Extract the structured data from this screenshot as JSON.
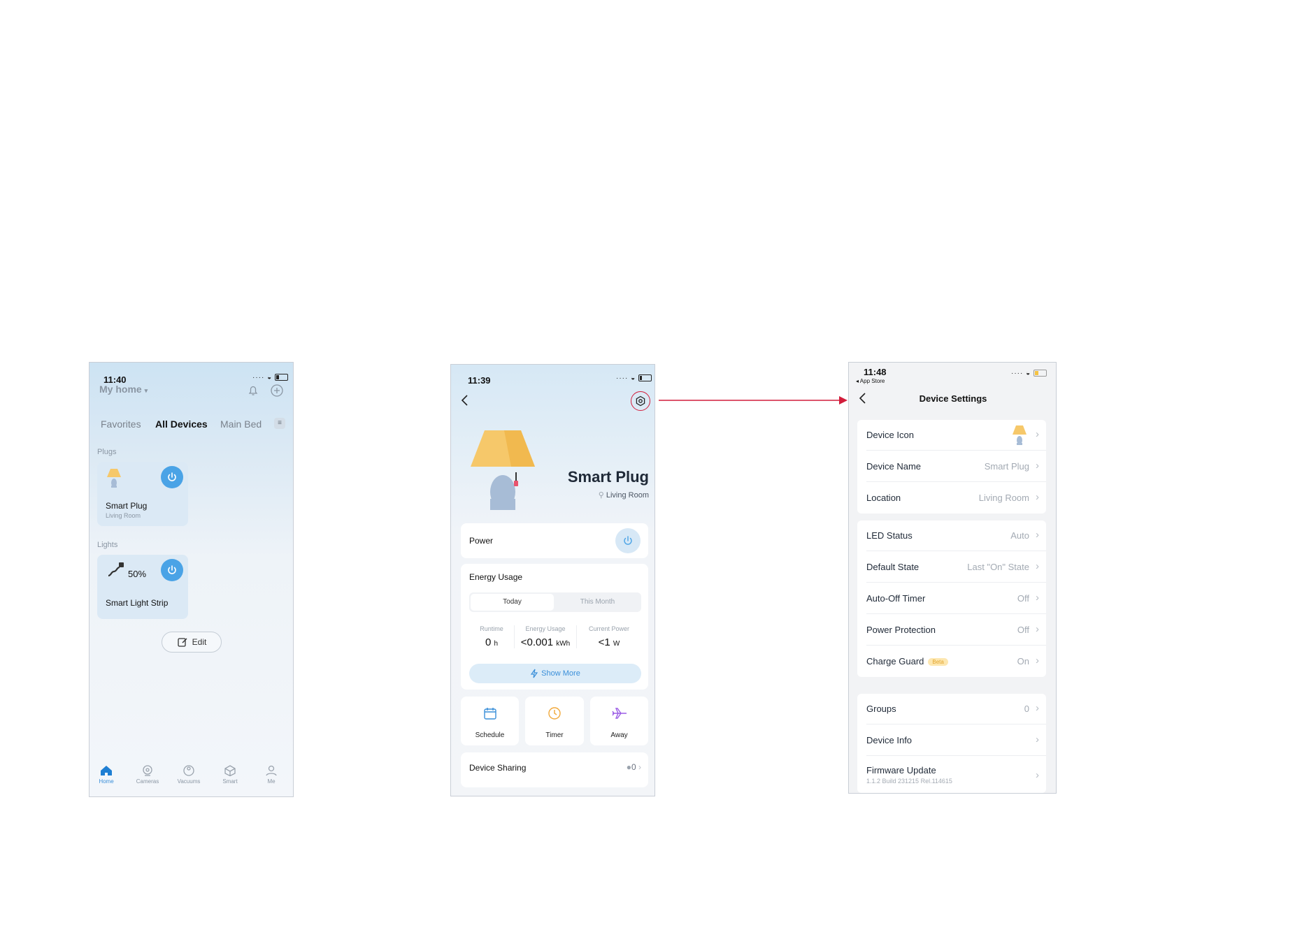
{
  "colors": {
    "accent": "#4aa3e6",
    "arrow": "#d21d3b",
    "beta": "#f5c242"
  },
  "screen1": {
    "status_time": "11:40",
    "home_title": "My home",
    "tabs": [
      "Favorites",
      "All Devices",
      "Main Bed"
    ],
    "active_tab": "All Devices",
    "section_plugs": "Plugs",
    "plug_name": "Smart Plug",
    "plug_room": "Living Room",
    "section_lights": "Lights",
    "strip_brightness": "50%",
    "strip_name": "Smart Light Strip",
    "edit_label": "Edit",
    "nav": [
      "Home",
      "Cameras",
      "Vacuums",
      "Smart",
      "Me"
    ]
  },
  "screen2": {
    "status_time": "11:39",
    "device_name": "Smart Plug",
    "device_room": "Living Room",
    "power_label": "Power",
    "energy_title": "Energy Usage",
    "energy_tabs": [
      "Today",
      "This Month"
    ],
    "stats": [
      {
        "label": "Runtime",
        "value": "0",
        "unit": "h"
      },
      {
        "label": "Energy Usage",
        "value": "<0.001",
        "unit": "kWh"
      },
      {
        "label": "Current Power",
        "value": "<1",
        "unit": "W"
      }
    ],
    "show_more": "Show More",
    "actions": [
      "Schedule",
      "Timer",
      "Away"
    ],
    "sharing_label": "Device Sharing",
    "sharing_count": "0"
  },
  "screen3": {
    "status_time": "11:48",
    "back_app": "◂ App Store",
    "title": "Device Settings",
    "group1": [
      {
        "label": "Device Icon",
        "value": ""
      },
      {
        "label": "Device Name",
        "value": "Smart Plug"
      },
      {
        "label": "Location",
        "value": "Living Room"
      }
    ],
    "group2": [
      {
        "label": "LED Status",
        "value": "Auto"
      },
      {
        "label": "Default State",
        "value": "Last \"On\" State"
      },
      {
        "label": "Auto-Off Timer",
        "value": "Off"
      },
      {
        "label": "Power Protection",
        "value": "Off"
      },
      {
        "label": "Charge Guard",
        "value": "On",
        "badge": "Beta"
      }
    ],
    "group3": [
      {
        "label": "Groups",
        "value": "0"
      },
      {
        "label": "Device Info",
        "value": ""
      },
      {
        "label": "Firmware Update",
        "value": "",
        "sub": "1.1.2 Build 231215 Rel.114615"
      }
    ]
  }
}
